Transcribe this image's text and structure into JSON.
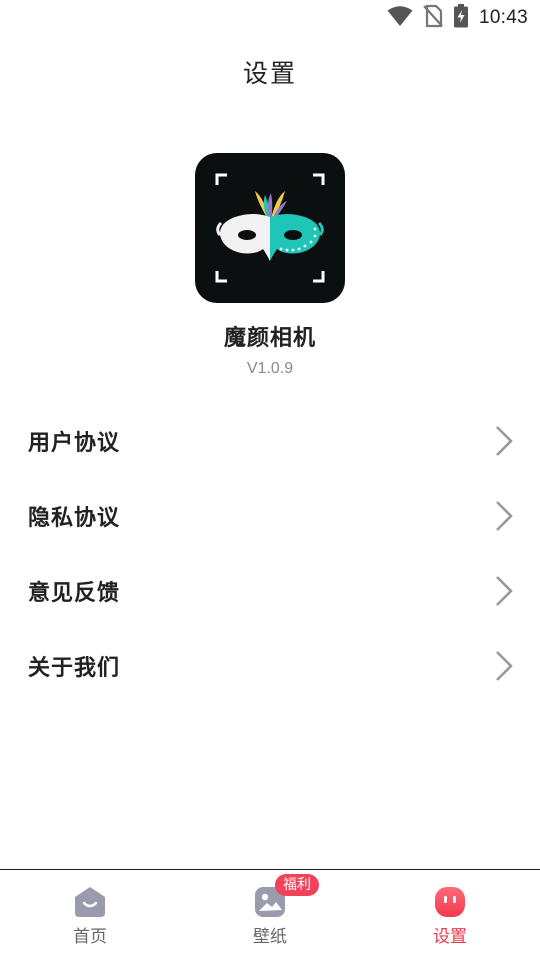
{
  "status_bar": {
    "time": "10:43",
    "icons": [
      "wifi-icon",
      "no-sim-icon",
      "battery-charging-icon"
    ]
  },
  "header": {
    "title": "设置"
  },
  "app": {
    "name": "魔颜相机",
    "version": "V1.0.9",
    "icon": "mask-app-icon"
  },
  "menu": {
    "items": [
      {
        "label": "用户协议",
        "icon": "chevron-right-icon"
      },
      {
        "label": "隐私协议",
        "icon": "chevron-right-icon"
      },
      {
        "label": "意见反馈",
        "icon": "chevron-right-icon"
      },
      {
        "label": "关于我们",
        "icon": "chevron-right-icon"
      }
    ]
  },
  "bottom_nav": {
    "items": [
      {
        "label": "首页",
        "icon": "home-icon"
      },
      {
        "label": "壁纸",
        "icon": "wallpaper-icon",
        "badge": "福利"
      },
      {
        "label": "设置",
        "icon": "settings-face-icon",
        "active": true
      }
    ]
  },
  "colors": {
    "accent": "#f0394e",
    "badge": "#f24158",
    "inactive_icon": "#9a9cae",
    "mask_teal": "#1fc6b8"
  }
}
